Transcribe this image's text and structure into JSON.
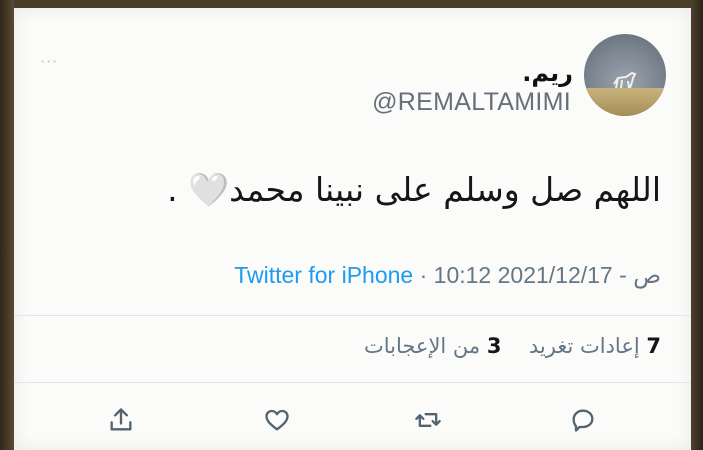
{
  "tweet": {
    "display_name": "ريم.",
    "handle": "@REMALTAMIMI",
    "text": "اللهم صل وسلم على نبينا محمد🤍 .",
    "date": "2021/12/17",
    "time": "10:12 ص",
    "separator": "·",
    "source": "Twitter for iPhone",
    "retweets_count": "7",
    "retweets_label": "إعادات تغريد",
    "likes_count": "3",
    "likes_label": "من الإعجابات"
  },
  "actions": [
    {
      "name": "reply-icon"
    },
    {
      "name": "retweet-icon"
    },
    {
      "name": "like-icon"
    },
    {
      "name": "share-icon"
    }
  ],
  "colors": {
    "accent": "#1d9bf0",
    "secondary_text": "#657786",
    "primary_text": "#14171a",
    "background": "#fbfbf9"
  },
  "more_icon": "more-dots-icon"
}
